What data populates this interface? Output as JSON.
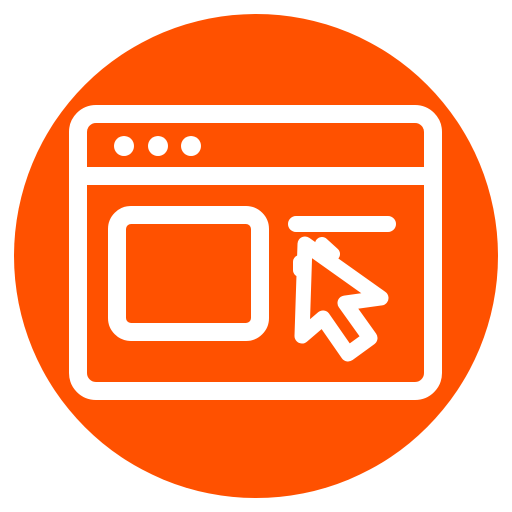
{
  "icon": {
    "name": "web-browser-click-icon",
    "description_visible_text": "",
    "colors": {
      "background_circle": "#FF5100",
      "line": "#FFFFFF",
      "page_background": "#FFFFFF"
    },
    "elements": [
      "browser-window-icon",
      "window-dots-icon",
      "content-image-placeholder-icon",
      "text-line-icon",
      "mouse-cursor-icon"
    ]
  }
}
